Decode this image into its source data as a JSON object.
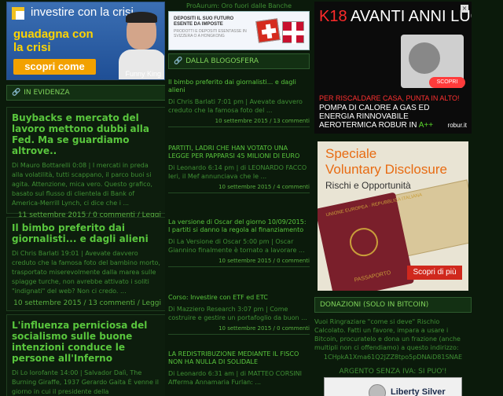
{
  "left": {
    "banner": {
      "title": "investire con la crisi",
      "slogan": "guadagna con la crisi",
      "button": "scopri come",
      "signature": "Funny King"
    },
    "section_title": "IN EVIDENZA",
    "posts": [
      {
        "title": "Buybacks e mercato del lavoro mettono dubbi alla Fed. Ma se guardiamo altrove..",
        "body": "Di Mauro Bottarelli 0:08 | I mercati in preda alla volatilità, tutti scappano, il parco buoi si agita. Attenzione, mica vero. Questo grafico, basato sul flusso di clientela di Bank of America-Merrill Lynch, ci dice che i ...",
        "meta": "11 settembre 2015 / 0 commenti / Leggi"
      },
      {
        "title": "Il bimbo preferito dai giornalisti... e dagli alieni",
        "body": "Di Chris Barlati 19:01 | Avevate davvero creduto che la famosa foto del bambino morto, trasportato miserevolmente dalla marea sulle spiagge turche, non avrebbe attivato i soliti \"indignati\" del web? Non ci credo. ...",
        "meta": "10 settembre 2015 / 13 commenti / Leggi"
      },
      {
        "title": "L'influenza perniciosa del socialismo sulle buone intenzioni conduce le persone all'Inferno",
        "body": "Di Lo Iorofante 14:00 | Salvador Dalì, The Burning Giraffe, 1937        Gerardo Gaita   È venne il giorno in cui il presidente della",
        "meta": ""
      }
    ]
  },
  "middle": {
    "top_link": "ProAurum: Oro fuori dalle Banche",
    "ad": {
      "line1": "DEPOSITI IL SUO FUTURO ESENTE DA IMPOSTE",
      "line2": "PRODOTTI E DEPOSITI ESENTASSE IN SVIZZERA O A HONGKONG"
    },
    "section_title": "DALLA BLOGOSFERA",
    "items": [
      {
        "title": "Il bimbo preferito dai giornalisti... e dagli alieni",
        "body": "Di Chris Barlati 7:01 pm | Avevate davvero creduto che la famosa foto del ...",
        "meta": "10 settembre 2015 / 13 commenti"
      },
      {
        "title": "PARTITI, LADRI CHE HAN VOTATO UNA LEGGE PER PAPPARSI 45 MILIONI DI EURO",
        "body": "Di Leonardo 6:14 pm | di LEONARDO FACCO Ieri, il Mef annunciava che le ...",
        "meta": "10 settembre 2015 / 4 commenti"
      },
      {
        "title": "La versione di Oscar del giorno 10/09/2015: I partiti si danno la regola al finanziamento",
        "body": "Di La Versione di Oscar 5:00 pm | Oscar Giannino finalmente è tornato a lavorare ...",
        "meta": "10 settembre 2015 / 0 commenti"
      },
      {
        "title": "Corso: Investire con ETF ed ETC",
        "body": "Di Mazziero Research 3:07 pm | Come costruire e gestire un portafoglio da buon ...",
        "meta": "10 settembre 2015 / 0 commenti"
      },
      {
        "title": "LA REDISTRIBUZIONE MEDIANTE IL FISCO NON HA NULLA DI SOLIDALE",
        "body": "Di Leonardo 6:31 am | di MATTEO CORSINI Afferma Annamaria Furlan: ...",
        "meta": ""
      }
    ]
  },
  "right": {
    "robur": {
      "headline_prefix": "K18",
      "headline": "AVANTI ANNI LUCE",
      "button": "SCOPRI",
      "red_line": "PER RISCALDARE CASA, PUNTA IN ALTO!",
      "white_line": "POMPA DI CALORE A GAS ED ENERGIA RINNOVABILE AEROTERMICA ROBUR IN",
      "energy_class": "A++",
      "brand": "robur.it"
    },
    "voluntary": {
      "line1": "Speciale",
      "line2": "Voluntary Disclosure",
      "line3": "Rischi e Opportunità",
      "passport_top": "UNIONE EUROPEA · REPUBBLICA ITALIANA",
      "passport_bottom": "PASSAPORTO",
      "cta": "Scopri di più"
    },
    "section_title": "DONAZIONI (SOLO IN BITCOIN)",
    "donation_text": "Vuoi Ringraziare \"come si deve\" Rischio Calcolato. Fatti un favore, impara a usare i Bitcoin, procuratelo e dona un frazione (anche multipli non ci offendiamo) a questo indirizzo:",
    "bitcoin_address": "1CHpkA1Xma61Q2JZZ8tpo5pDNAiD81SNAE",
    "argento": "ARGENTO SENZA IVA: SI PUO'!",
    "liberty": "Liberty Silver"
  }
}
